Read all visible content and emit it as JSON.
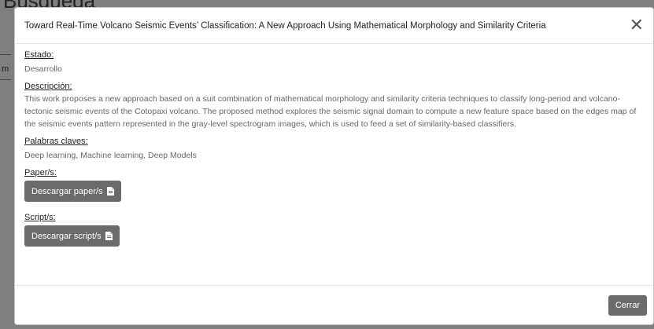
{
  "background": {
    "heading": "Búsqueda",
    "side_letter": "m"
  },
  "modal": {
    "title": "Toward Real-Time Volcano Seismic Events’ Classification: A New Approach Using Mathematical Morphology and Similarity Criteria",
    "close_glyph": "✕",
    "estado_label": "Estado:",
    "estado_value": "Desarrollo",
    "descripcion_label": "Descripción:",
    "descripcion_value": "This work proposes a new approach based on a suit combination of mathematical morphology and similarity criteria techniques to classify long-period and volcano-tectonic seismic events of the Cotopaxi volcano. The proposed method explores the seismic signal domain to compute a new feature space based on the edges map of the seismic events pattern represented in the gray-level spectrogram images, which is used to feed a set of similarity-based classifiers.",
    "palabras_label": "Palabras claves:",
    "palabras_value": "Deep learning, Machine learning, Deep Models",
    "paper_label": "Paper/s:",
    "paper_button": "Descargar paper/s",
    "script_label": "Script/s:",
    "script_button": "Descargar script/s",
    "close_button": "Cerrar"
  },
  "icons": {
    "close": "close-icon",
    "file": "file-icon"
  },
  "colors": {
    "button_bg": "#6b6b6b",
    "backdrop": "rgba(0,0,0,0.5)"
  }
}
